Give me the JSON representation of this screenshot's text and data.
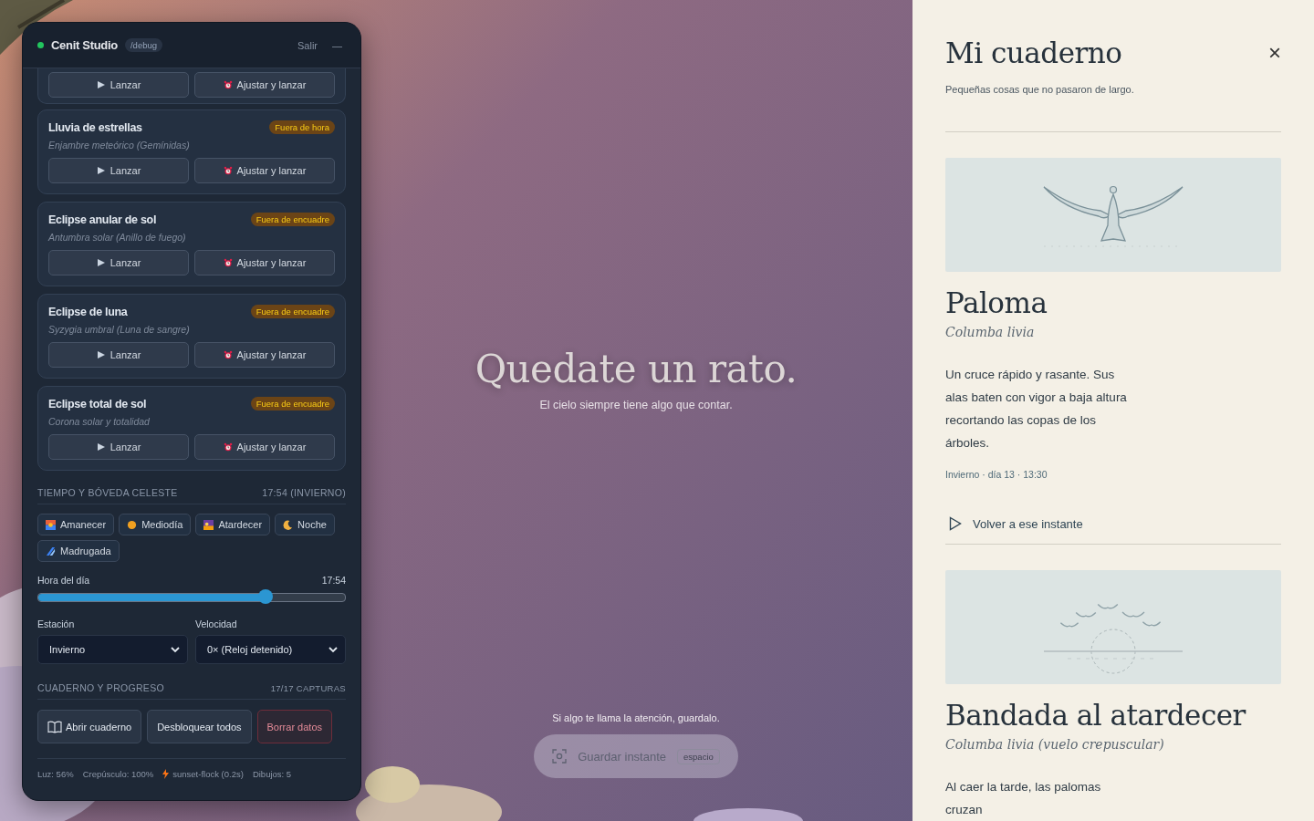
{
  "debug_panel": {
    "title": "Cenit Studio",
    "route": "/debug",
    "exit": "Salir",
    "minimize": "—",
    "events": [
      {
        "buttons": [
          "Lanzar",
          "Ajustar y lanzar"
        ]
      },
      {
        "title": "Lluvia de estrellas",
        "subtitle": "Enjambre meteórico (Gemínidas)",
        "badge": "Fuera de hora",
        "buttons": [
          "Lanzar",
          "Ajustar y lanzar"
        ]
      },
      {
        "title": "Eclipse anular de sol",
        "subtitle": "Antumbra solar (Anillo de fuego)",
        "badge": "Fuera de encuadre",
        "buttons": [
          "Lanzar",
          "Ajustar y lanzar"
        ]
      },
      {
        "title": "Eclipse de luna",
        "subtitle": "Syzygia umbral (Luna de sangre)",
        "badge": "Fuera de encuadre",
        "buttons": [
          "Lanzar",
          "Ajustar y lanzar"
        ]
      },
      {
        "title": "Eclipse total de sol",
        "subtitle": "Corona solar y totalidad",
        "badge": "Fuera de encuadre",
        "buttons": [
          "Lanzar",
          "Ajustar y lanzar"
        ]
      }
    ],
    "time_section": {
      "heading": "TIEMPO Y BÓVEDA CELESTE",
      "summary": "17:54 (INVIERNO)",
      "presets": [
        {
          "label": "Amanecer",
          "kind": "sunrise"
        },
        {
          "label": "Mediodía",
          "kind": "sun"
        },
        {
          "label": "Atardecer",
          "kind": "sunset"
        },
        {
          "label": "Noche",
          "kind": "moon"
        },
        {
          "label": "Madrugada",
          "kind": "dawn"
        }
      ],
      "slider": {
        "label": "Hora del día",
        "reading": "17:54",
        "level": 0.74
      },
      "season": {
        "label": "Estación",
        "value": "Invierno"
      },
      "speed": {
        "label": "Velocidad",
        "value": "0× (Reloj detenido)"
      }
    },
    "progress_section": {
      "heading": "CUADERNO Y PROGRESO",
      "summary": "17/17 CAPTURAS",
      "buttons": [
        {
          "label": "Abrir cuaderno",
          "kind": "book"
        },
        {
          "label": "Desbloquear todos",
          "kind": "plain"
        },
        {
          "label": "Borrar datos",
          "kind": "danger"
        }
      ]
    },
    "stats": [
      "Luz: 56%",
      "Crepúsculo: 100%",
      "sunset-flock (0.2s)",
      "Dibujos: 5"
    ]
  },
  "stage": {
    "headline": "Quedate un rato.",
    "tagline": "El cielo siempre tiene algo que contar.",
    "hint": "Si algo te llama la atención, guardalo.",
    "save_button": "Guardar instante",
    "shortcut": "espacio"
  },
  "notebook": {
    "title": "Mi cuaderno",
    "close": "×",
    "subtitle": "Pequeñas cosas que no pasaron de largo.",
    "entries": [
      {
        "kind": "single",
        "title": "Paloma",
        "latin": "Columba livia",
        "description": "Un cruce rápido y rasante. Sus alas baten con vigor a baja altura recortando las copas de los árboles.",
        "meta": "Invierno · día 13 · 13:30",
        "action": "Volver a ese instante"
      },
      {
        "kind": "flock",
        "title": "Bandada al atardecer",
        "latin": "Columba livia (vuelo crepuscular)",
        "description": "Al caer la tarde, las palomas cruzan"
      }
    ]
  }
}
